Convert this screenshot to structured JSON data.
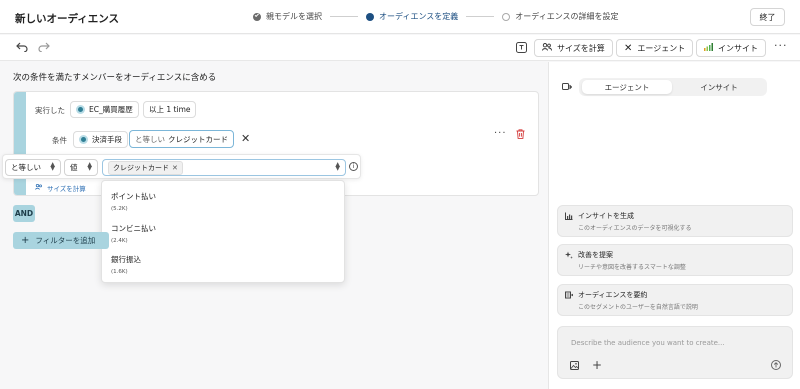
{
  "header": {
    "title": "新しいオーディエンス",
    "steps": [
      {
        "label": "親モデルを選択",
        "state": "done"
      },
      {
        "label": "オーディエンスを定義",
        "state": "current"
      },
      {
        "label": "オーディエンスの詳細を設定",
        "state": "pending"
      }
    ],
    "finish_label": "終了"
  },
  "toolbar": {
    "undo_icon": "undo-icon",
    "redo_icon": "redo-icon",
    "size_calc_label": "サイズを計算",
    "agent_label": "エージェント",
    "insight_label": "インサイト",
    "more_icon": "more-icon"
  },
  "builder": {
    "heading": "次の条件を満たすメンバーをオーディエンスに含める",
    "performed_label": "実行した",
    "event_name": "EC_購買履歴",
    "frequency": "以上 1 time",
    "condition_label": "条件",
    "condition_property": "決済手段",
    "condition_operator": "と等しい",
    "condition_value": "クレジットカード",
    "size_link": "サイズを計算",
    "and_label": "AND",
    "add_filter_label": "フィルターを追加"
  },
  "editor": {
    "operator_select": "と等しい",
    "type_select": "値",
    "selected_tag": "クレジットカード",
    "options": [
      {
        "name": "ポイント払い",
        "count": "(5.2K)"
      },
      {
        "name": "コンビニ払い",
        "count": "(2.4K)"
      },
      {
        "name": "銀行振込",
        "count": "(1.6K)"
      }
    ]
  },
  "panel": {
    "tabs": [
      "エージェント",
      "インサイト"
    ],
    "active_tab": "エージェント",
    "suggestions": [
      {
        "title": "インサイトを生成",
        "desc": "このオーディエンスのデータを可視化する",
        "icon": "chart-icon"
      },
      {
        "title": "改善を提案",
        "desc": "リーチや意図を改善するスマートな調整",
        "icon": "sparkle-icon"
      },
      {
        "title": "オーディエンスを要約",
        "desc": "このセグメントのユーザーを自然言語で説明",
        "icon": "summary-icon"
      }
    ],
    "chat_placeholder": "Describe the audience you want to create..."
  },
  "colors": {
    "accent": "#1d4f82",
    "filter_bar": "#a9d4df",
    "delete": "#d43a3a",
    "link": "#2a6db3"
  }
}
